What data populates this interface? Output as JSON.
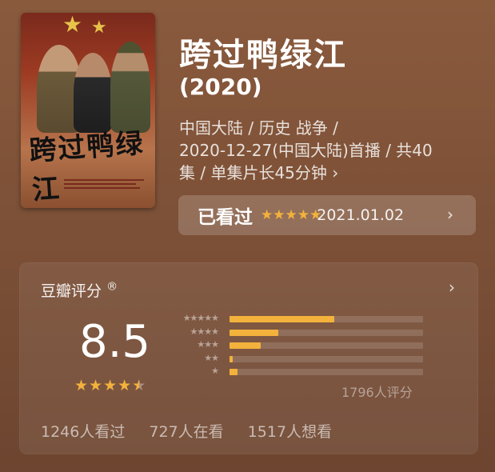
{
  "movie": {
    "title": "跨过鸭绿江",
    "year": "(2020)",
    "poster_title": "跨过鸭绿江",
    "meta_line1": "中国大陆 / 历史 战争 /",
    "meta_line2": "2020-12-27(中国大陆)首播 / 共40",
    "meta_line3": "集 / 单集片长45分钟 ›"
  },
  "watched": {
    "label": "已看过",
    "rating_stars": 5,
    "date": "2021.01.02"
  },
  "rating": {
    "header": "豆瓣评分",
    "reg_mark": "®",
    "score": "8.5",
    "stars_value": 4.5,
    "count_label": "1796人评分",
    "distribution": [
      {
        "stars": 5,
        "percent": 54
      },
      {
        "stars": 4,
        "percent": 25
      },
      {
        "stars": 3,
        "percent": 16
      },
      {
        "stars": 2,
        "percent": 1
      },
      {
        "stars": 1,
        "percent": 4
      }
    ],
    "star_color": "#f3b23b"
  },
  "stats": {
    "watched": "1246人看过",
    "watching": "727人在看",
    "want": "1517人想看"
  },
  "icons": {
    "chevron": "chevron-right-icon",
    "star": "star-icon"
  }
}
